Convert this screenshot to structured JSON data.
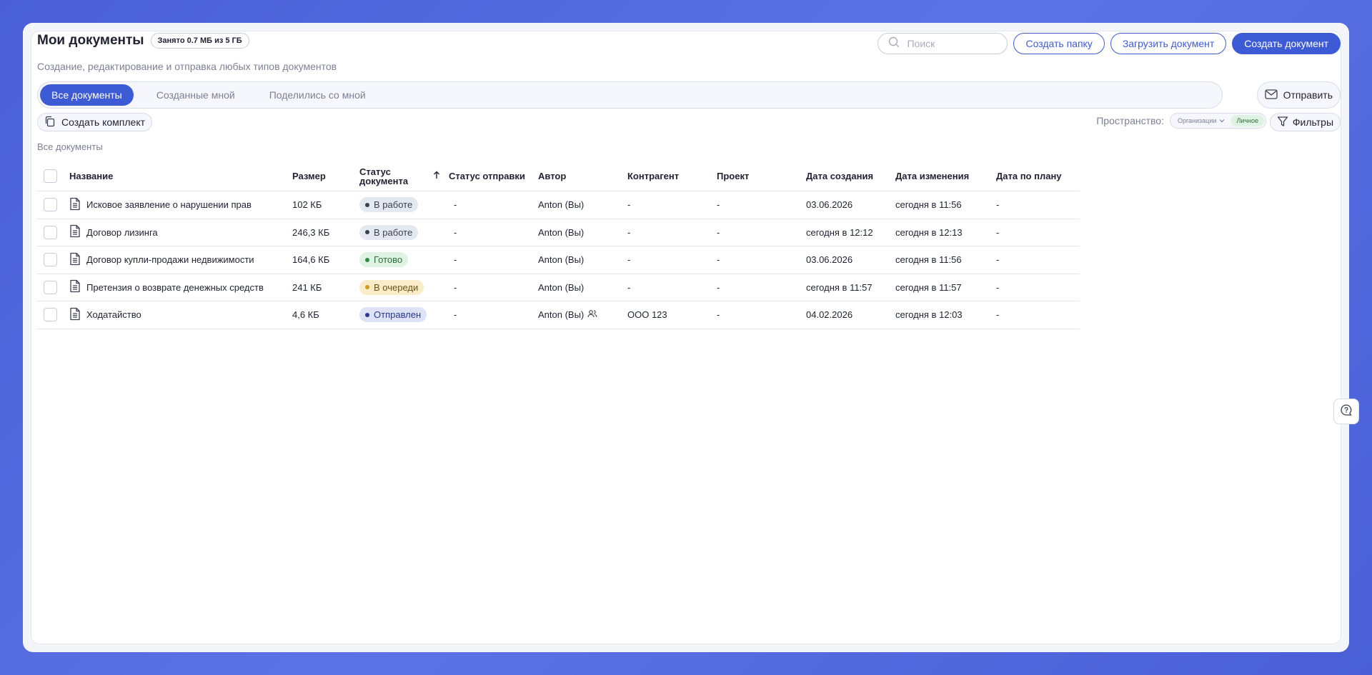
{
  "header": {
    "title": "Мои документы",
    "storage": "Занято 0.7 МБ из 5 ГБ",
    "subtitle": "Создание, редактирование и отправка любых типов документов"
  },
  "search": {
    "placeholder": "Поиск"
  },
  "actions": {
    "create_folder": "Создать папку",
    "upload_document": "Загрузить документ",
    "create_document": "Создать документ"
  },
  "tabs": [
    {
      "label": "Все документы",
      "active": true
    },
    {
      "label": "Созданные мной",
      "active": false
    },
    {
      "label": "Поделились со мной",
      "active": false
    }
  ],
  "send_button": "Отправить",
  "create_set_button": "Создать комплект",
  "space": {
    "label": "Пространство:",
    "options": [
      {
        "label": "Организации",
        "active": false
      },
      {
        "label": "Личное",
        "active": true
      }
    ]
  },
  "filters_button": "Фильтры",
  "section_label": "Все документы",
  "table": {
    "columns": {
      "name": "Название",
      "size": "Размер",
      "status_line1": "Статус",
      "status_line2": "документа",
      "send_status": "Статус отправки",
      "author": "Автор",
      "counterparty": "Контрагент",
      "project": "Проект",
      "created": "Дата создания",
      "modified": "Дата изменения",
      "planned": "Дата по плану"
    },
    "rows": [
      {
        "name": "Исковое заявление о нарушении прав",
        "size": "102 КБ",
        "status": "В работе",
        "status_kind": "work",
        "send_status": "-",
        "author": "Anton (Вы)",
        "shared": false,
        "counterparty": "-",
        "project": "-",
        "created": "03.06.2026",
        "modified": "сегодня в 11:56",
        "planned": "-"
      },
      {
        "name": "Договор лизинга",
        "size": "246,3 КБ",
        "status": "В работе",
        "status_kind": "work",
        "send_status": "-",
        "author": "Anton (Вы)",
        "shared": false,
        "counterparty": "-",
        "project": "-",
        "created": "сегодня в 12:12",
        "modified": "сегодня в 12:13",
        "planned": "-"
      },
      {
        "name": "Договор купли-продажи недвижимости",
        "size": "164,6 КБ",
        "status": "Готово",
        "status_kind": "ready",
        "send_status": "-",
        "author": "Anton (Вы)",
        "shared": false,
        "counterparty": "-",
        "project": "-",
        "created": "03.06.2026",
        "modified": "сегодня в 11:56",
        "planned": "-"
      },
      {
        "name": "Претензия о возврате денежных средств",
        "size": "241 КБ",
        "status": "В очереди",
        "status_kind": "queue",
        "send_status": "-",
        "author": "Anton (Вы)",
        "shared": false,
        "counterparty": "-",
        "project": "-",
        "created": "сегодня в 11:57",
        "modified": "сегодня в 11:57",
        "planned": "-"
      },
      {
        "name": "Ходатайство",
        "size": "4,6 КБ",
        "status": "Отправлен",
        "status_kind": "sent",
        "send_status": "-",
        "author": "Anton (Вы)",
        "shared": true,
        "counterparty": "ООО 123",
        "project": "-",
        "created": "04.02.2026",
        "modified": "сегодня в 12:03",
        "planned": "-"
      }
    ]
  },
  "colors": {
    "accent": "#3e5bd6",
    "background": "#4a5fd6",
    "status_work": "#e4e8f1",
    "status_ready": "#dff3e3",
    "status_queue": "#fbecc9",
    "status_sent": "#dde2f7"
  },
  "icons": [
    "search-icon",
    "envelope-icon",
    "copy-icon",
    "chevron-down-icon",
    "filter-icon",
    "sort-arrow-up-icon",
    "document-icon",
    "users-icon",
    "help-chat-icon"
  ]
}
